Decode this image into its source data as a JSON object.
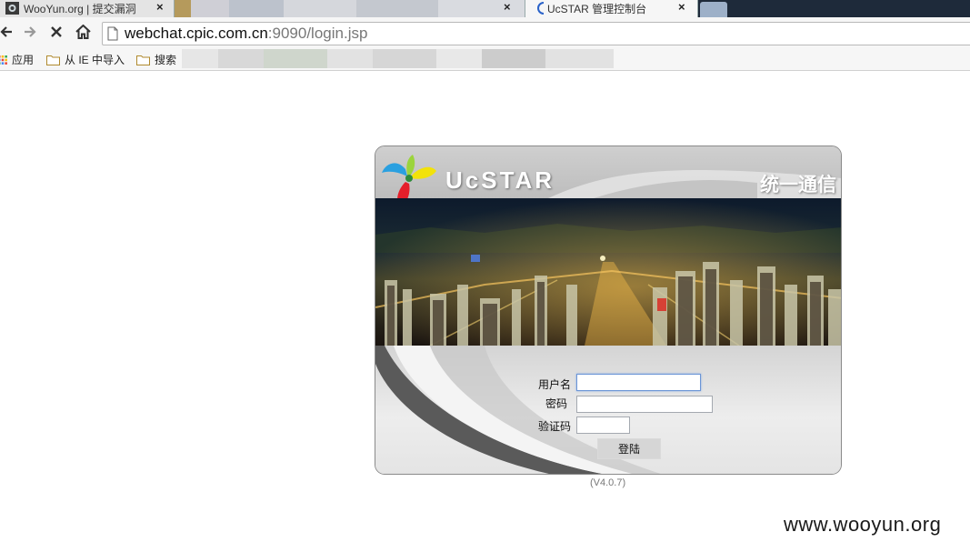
{
  "browser": {
    "tabs": [
      {
        "title": "WooYun.org | 提交漏洞",
        "close": "×"
      },
      {
        "title": "",
        "close": "×"
      },
      {
        "title": "UcSTAR 管理控制台",
        "close": "×"
      }
    ],
    "url": {
      "host": "webchat.cpic.com.cn",
      "rest": ":9090/login.jsp"
    },
    "bookmarks": {
      "apps_label": "应用",
      "import_label": "从 IE 中导入",
      "search_label": "搜索"
    }
  },
  "login": {
    "brand": "UcSTAR",
    "slogan": "统一通信",
    "username_label": "用户名",
    "password_label": "密码",
    "captcha_label": "验证码",
    "username_value": "",
    "password_value": "",
    "captcha_value": "",
    "submit_label": "登陆",
    "version": "(V4.0.7)"
  },
  "watermark": "www.wooyun.org",
  "colors": {
    "tabstrip": "#1e2a3a",
    "panel_border": "#8a8a8a",
    "input_focus": "#6b95d6"
  }
}
